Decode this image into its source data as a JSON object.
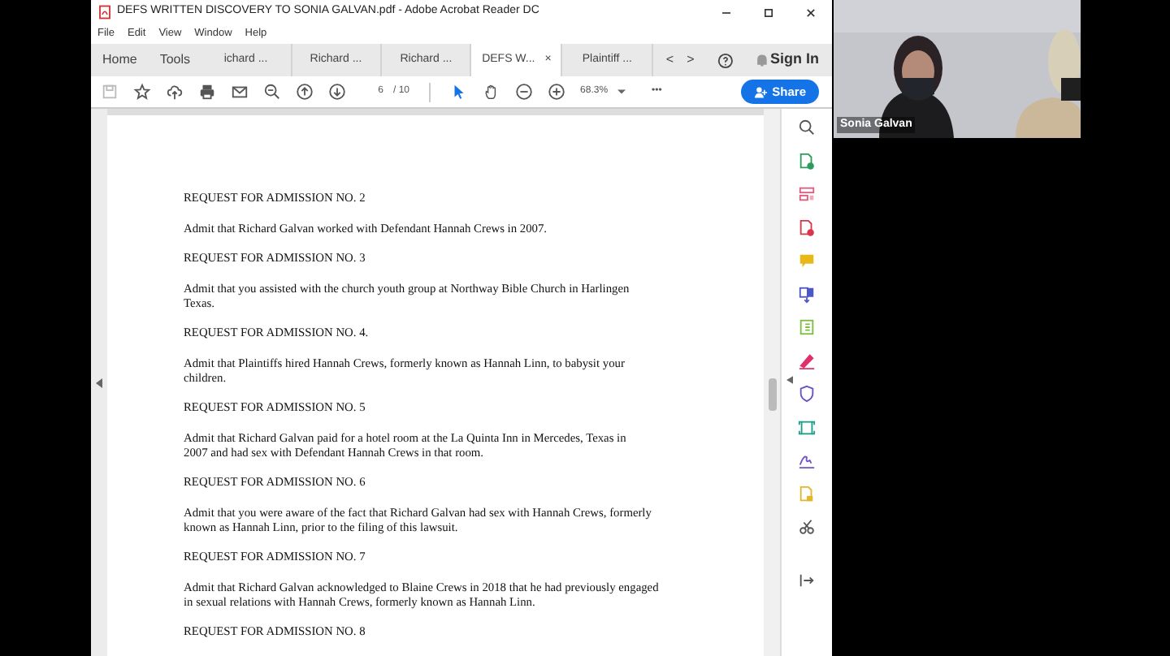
{
  "window": {
    "title": "DEFS WRITTEN DISCOVERY TO SONIA GALVAN.pdf - Adobe Acrobat Reader DC"
  },
  "menu": [
    "File",
    "Edit",
    "View",
    "Window",
    "Help"
  ],
  "tabs": [
    {
      "label": "Home",
      "kind": "nav",
      "selected": false
    },
    {
      "label": "Tools",
      "kind": "nav",
      "selected": false
    },
    {
      "label": "ichard ...",
      "kind": "doc",
      "selected": false
    },
    {
      "label": "Richard ...",
      "kind": "doc",
      "selected": false
    },
    {
      "label": "Richard ...",
      "kind": "doc",
      "selected": false
    },
    {
      "label": "DEFS W...",
      "kind": "doc",
      "selected": true,
      "close": "×"
    },
    {
      "label": "Plaintiff ...",
      "kind": "doc",
      "selected": false
    }
  ],
  "tab_arrows": [
    "<",
    ">"
  ],
  "sign_in": "Sign In",
  "toolbar": {
    "save_disabled": true,
    "tools": [
      {
        "kind": "star"
      },
      {
        "kind": "upload"
      },
      {
        "kind": "print"
      },
      {
        "kind": "mail"
      },
      {
        "kind": "zoom-search"
      },
      {
        "kind": "up"
      },
      {
        "kind": "down"
      }
    ],
    "modes": [
      {
        "kind": "pointer",
        "selected": true
      },
      {
        "kind": "hand",
        "selected": false
      }
    ],
    "zoom_tools": [
      {
        "kind": "minus"
      },
      {
        "kind": "plus"
      }
    ],
    "page_current": "6",
    "page_total": "/ 10",
    "zoom_value": "68.3%",
    "more": "•••",
    "share": "Share"
  },
  "document": {
    "requests": [
      {
        "heading": "REQUEST FOR ADMISSION NO. 2",
        "body": [
          "Admit that Richard Galvan worked with Defendant Hannah Crews in 2007."
        ]
      },
      {
        "heading": "REQUEST FOR ADMISSION NO. 3",
        "body": [
          "Admit that you assisted with the church youth group at Northway Bible Church in Harlingen",
          "Texas."
        ]
      },
      {
        "heading": "REQUEST FOR ADMISSION NO. 4.",
        "body": [
          "Admit that Plaintiffs hired Hannah Crews, formerly known as Hannah Linn, to babysit your",
          "children."
        ]
      },
      {
        "heading": "REQUEST FOR ADMISSION NO. 5",
        "body": [
          "Admit that Richard Galvan paid for a hotel room at the La Quinta Inn in Mercedes, Texas in",
          "2007 and had sex with Defendant Hannah Crews in that room."
        ]
      },
      {
        "heading": "REQUEST FOR ADMISSION NO. 6",
        "body": [
          "Admit that you were aware of the fact that Richard Galvan had sex with Hannah Crews, formerly",
          "known as Hannah Linn, prior to the filing of this lawsuit."
        ]
      },
      {
        "heading": "REQUEST FOR ADMISSION NO. 7",
        "body": [
          "Admit that Richard Galvan acknowledged to Blaine Crews in 2018 that he had previously engaged",
          "in sexual relations with Hannah Crews, formerly known as Hannah Linn."
        ]
      },
      {
        "heading": "REQUEST FOR ADMISSION NO. 8"
      }
    ]
  },
  "right_tools": [
    {
      "kind": "search"
    },
    {
      "kind": "export"
    },
    {
      "kind": "organize"
    },
    {
      "kind": "create"
    },
    {
      "kind": "comment"
    },
    {
      "kind": "combine"
    },
    {
      "kind": "edit"
    },
    {
      "kind": "fill"
    },
    {
      "kind": "protect"
    },
    {
      "kind": "scan"
    },
    {
      "kind": "sign"
    },
    {
      "kind": "compress"
    },
    {
      "kind": "more-tools"
    },
    {
      "kind": "collapse"
    }
  ],
  "video": {
    "kind": "picture",
    "name": "Sonia Galvan"
  }
}
